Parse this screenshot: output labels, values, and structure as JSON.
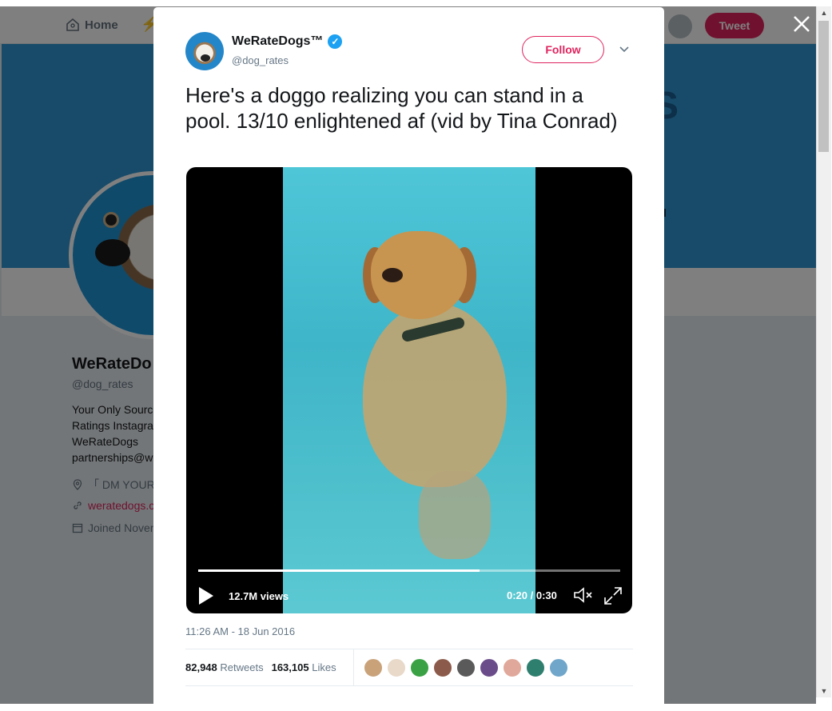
{
  "page": {
    "nav": {
      "home_label": "Home",
      "tweet_button": "Tweet"
    },
    "profile": {
      "name": "WeRateDo",
      "handle": "@dog_rates",
      "bio_lines": [
        "Your Only Source",
        "Ratings Instagram",
        "WeRateDogs",
        "partnerships@we"
      ],
      "location": "「 DM YOUR",
      "website": "weratedogs.c",
      "joined": "Joined Novem"
    }
  },
  "tweet": {
    "display_name": "WeRateDogs™",
    "handle": "@dog_rates",
    "verified": true,
    "follow_label": "Follow",
    "text": "Here's a doggo realizing you can stand in a pool. 13/10 enlightened af (vid by Tina Conrad)",
    "video": {
      "views": "12.7M views",
      "time": "0:20 / 0:30",
      "progress": 0.667
    },
    "timestamp": "11:26 AM - 18 Jun 2016",
    "retweets_count": "82,948",
    "retweets_label": "Retweets",
    "likes_count": "163,105",
    "likes_label": "Likes"
  },
  "colors": {
    "accent": "#e0245e",
    "verified": "#1da1f2",
    "banner": "#2e97d3"
  },
  "likers": [
    {
      "color": "#c9a27a"
    },
    {
      "color": "#e8d9c9"
    },
    {
      "color": "#3aa244"
    },
    {
      "color": "#8b5a4a"
    },
    {
      "color": "#5a5a5a"
    },
    {
      "color": "#6a4c8a"
    },
    {
      "color": "#e0a89a"
    },
    {
      "color": "#2f7f6f"
    },
    {
      "color": "#6fa6c9"
    }
  ],
  "icons": {
    "close": "✕",
    "caret": "⌄",
    "scroll_up": "▲",
    "scroll_down": "▼"
  }
}
